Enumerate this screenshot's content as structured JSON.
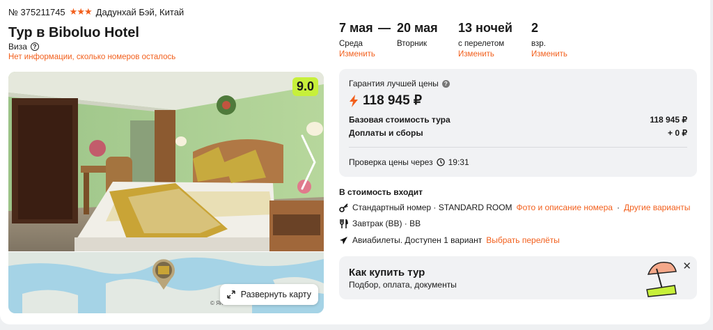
{
  "header": {
    "tour_number": "№ 375211745",
    "stars": "★★★",
    "location": "Дадунхай Бэй, Китай",
    "title": "Тур в Biboluo Hotel",
    "visa": "Виза",
    "visa_help_icon": "?",
    "rooms_note": "Нет информации, сколько номеров осталось"
  },
  "gallery": {
    "rating": "9.0",
    "next_icon": "chevron-right-icon"
  },
  "map": {
    "expand_label": "Развернуть карту",
    "copyright": "© Ян"
  },
  "trip": {
    "start_date": "7 мая",
    "start_day": "Среда",
    "start_change": "Изменить",
    "separator": "—",
    "end_date": "20 мая",
    "end_day": "Вторник",
    "nights": "13 ночей",
    "nights_note": "с перелетом",
    "nights_change": "Изменить",
    "guests": "2",
    "guests_note": "взр.",
    "guests_change": "Изменить"
  },
  "price": {
    "guarantee_label": "Гарантия лучшей цены",
    "total": "118 945 ₽",
    "base_label": "Базовая стоимость тура",
    "base_value": "118 945 ₽",
    "extra_label": "Доплаты и сборы",
    "extra_value": "+ 0 ₽",
    "check_label": "Проверка цены через",
    "check_time": "19:31"
  },
  "included": {
    "title": "В стоимость входит",
    "room_text": "Стандартный номер · STANDARD ROOM",
    "room_link1": "Фото и описание номера",
    "room_sep": "·",
    "room_link2": "Другие варианты",
    "meal_text": "Завтрак (BB) · BB",
    "flight_text": "Авиабилеты. Доступен 1 вариант",
    "flight_link": "Выбрать перелёты"
  },
  "howto": {
    "title": "Как купить тур",
    "subtitle": "Подбор, оплата, документы",
    "close": "✕"
  },
  "colors": {
    "accent": "#f25f1c",
    "rating_bg": "#c7f03a",
    "panel_bg": "#f1f2f4"
  }
}
